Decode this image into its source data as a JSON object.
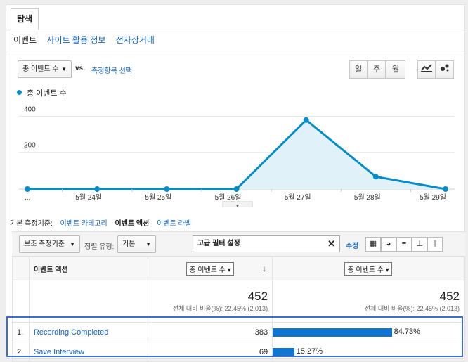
{
  "tab": "탐색",
  "subtabs": [
    "이벤트",
    "사이트 활용 정보",
    "전자상거래"
  ],
  "metric_dropdown": "총 이벤트 수",
  "vs_label": "vs.",
  "compare_link": "측정항목 선택",
  "period_buttons": [
    "일",
    "주",
    "월"
  ],
  "legend_label": "총 이벤트 수",
  "colors": {
    "line": "#058dc7",
    "area": "#e1f1f9",
    "bar": "#0f75d1",
    "link": "#1565c0"
  },
  "chart_data": {
    "type": "area",
    "x": [
      "...",
      "5월 24일",
      "5월 25일",
      "5월 26일",
      "5월 27일",
      "5월 28일",
      "5월 29일"
    ],
    "series": [
      {
        "values": [
          0,
          0,
          0,
          0,
          383,
          69,
          0
        ]
      }
    ],
    "yticks": [
      "400",
      "200"
    ],
    "ylim": [
      0,
      460
    ]
  },
  "dimension": {
    "label": "기본 측정기준:",
    "options": [
      "이벤트 카테고리",
      "이벤트 액션",
      "이벤트 라벨"
    ],
    "active": "이벤트 액션"
  },
  "toolbar": {
    "secondary_dim": "보조 측정기준",
    "sort_label": "정렬 유형:",
    "sort_value": "기본",
    "search_value": "고급 필터 설정",
    "edit_label": "수정"
  },
  "table": {
    "col_dimension": "이벤트 액션",
    "col_metric": "총 이벤트 수",
    "col_metric2": "총 이벤트 수",
    "total": "452",
    "total_note": "전체 대비 비율(%): 22.45% (2,013)",
    "total2": "452",
    "total_note2": "전체 대비 비율(%): 22.45% (2,013)",
    "rows": [
      {
        "num": "1.",
        "action": "Recording Completed",
        "events": "383",
        "pct_label": "84.73%",
        "pct": 84.73
      },
      {
        "num": "2.",
        "action": "Save Interview",
        "events": "69",
        "pct_label": "15.27%",
        "pct": 15.27
      }
    ]
  }
}
